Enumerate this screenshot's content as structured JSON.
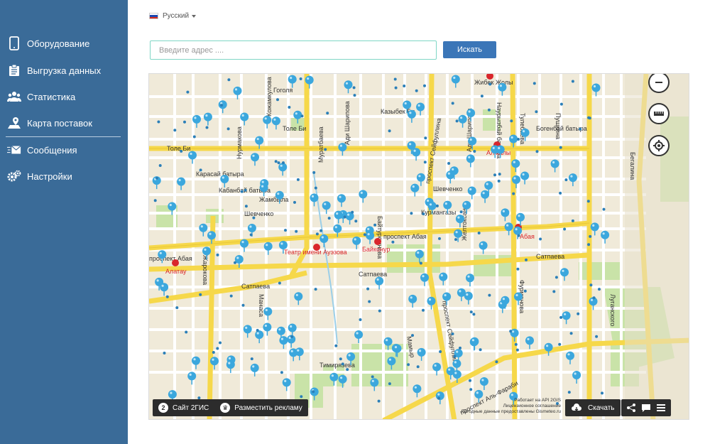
{
  "sidebar": {
    "items": [
      {
        "label": "Оборудование",
        "icon": "phone-icon"
      },
      {
        "label": "Выгрузка данных",
        "icon": "clipboard-icon"
      },
      {
        "label": "Статистика",
        "icon": "users-icon"
      },
      {
        "label": "Карта поставок",
        "icon": "map-pin-icon"
      },
      {
        "label": "Сообщения",
        "icon": "envelope-icon"
      },
      {
        "label": "Настройки",
        "icon": "gears-icon"
      }
    ]
  },
  "language": {
    "label": "Русский"
  },
  "search": {
    "placeholder": "Введите адрес ....",
    "value": "",
    "button_label": "Искать"
  },
  "map": {
    "streets": [
      "Гоголя",
      "Казыбек Би",
      "Жибек Жолы",
      "Толе Би",
      "Богенбай батыра",
      "Карасай батыра",
      "Кабанбай батыра",
      "Жамбыла",
      "Шевченко",
      "Курмангазы",
      "проспект Абая",
      "Сатпаева",
      "Тимирязева",
      "Абая",
      "Театр имени Ауэзова",
      "Байконур",
      "Алатау",
      "Алмалы",
      "Бегалина",
      "Пушкина",
      "Тулебаева",
      "Желтоксан",
      "Фурманова",
      "проспект Сейфуллина",
      "проспект Аль-Фараби",
      "Мамыр",
      "Ади Шарипова",
      "Наурызбай батыра",
      "Муратбаева",
      "Манаса",
      "Луганского",
      "Байтурсынова",
      "Жарокова",
      "Кожамкулова",
      "Нурмакова"
    ],
    "credits": [
      "Работает на API 2GIS",
      "Лицензионное соглашение",
      "Погодные данные предоставлены Gismeteo.ru"
    ],
    "site_label": "Сайт 2ГИС",
    "ads_label": "Разместить рекламу",
    "download_label": "Скачать"
  },
  "colors": {
    "sidebar": "#3a6b98",
    "accent": "#3b76b8",
    "marker": "#3ba7dd",
    "road": "#f6d84a",
    "metro": "#d9262c"
  }
}
